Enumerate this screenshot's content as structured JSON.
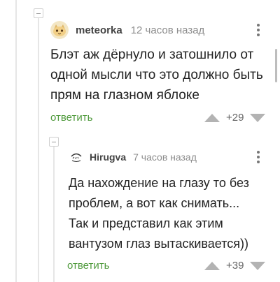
{
  "comments": [
    {
      "username": "meteorka",
      "time": "12 часов назад",
      "avatar_icon": "cat-avatar",
      "text_lines": [
        "Блэт аж дёрнуло и затошнило от",
        "одной мысли что это должно быть",
        "прям на глазном яблоке"
      ],
      "reply_label": "ответить",
      "rating": "+29"
    },
    {
      "username": "Hirugva",
      "time": "7 часов назад",
      "avatar_icon": "sketch-avatar",
      "text_lines": [
        "Да нахождение на глазу то без",
        "проблем, а вот как снимать...",
        "Так и представил как этим",
        "вантузом глаз вытаскивается))"
      ],
      "reply_label": "ответить",
      "rating": "+39"
    }
  ],
  "colors": {
    "reply_link": "#4f9a3c",
    "vote_arrow": "#b3b3b3",
    "thread_line": "#e6e6e6"
  }
}
